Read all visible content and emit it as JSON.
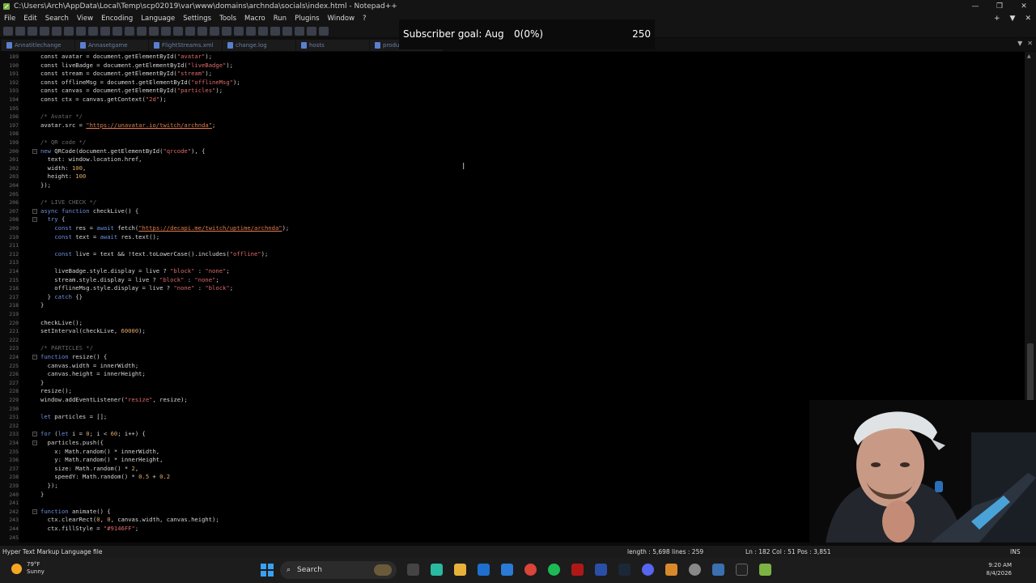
{
  "window": {
    "title": "C:\\Users\\Arch\\AppData\\Local\\Temp\\scp02019\\var\\www\\domains\\archnda\\socials\\index.html - Notepad++",
    "controls": [
      "—",
      "❐",
      "✕"
    ]
  },
  "menu": {
    "items": [
      "File",
      "Edit",
      "Search",
      "View",
      "Encoding",
      "Language",
      "Settings",
      "Tools",
      "Macro",
      "Run",
      "Plugins",
      "Window",
      "?"
    ],
    "right": [
      "+",
      "▼",
      "✕"
    ]
  },
  "tabs": [
    {
      "label": "Annatitlechange"
    },
    {
      "label": "Annasetgame"
    },
    {
      "label": "FlightStreams.xml"
    },
    {
      "label": "change.log"
    },
    {
      "label": "hosts"
    },
    {
      "label": "product.js"
    }
  ],
  "tabs_right": [
    "▼",
    "✕"
  ],
  "overlay": {
    "label": "Subscriber goal: Aug",
    "count": "0(0%)",
    "goal": "250"
  },
  "code": [
    {
      "n": "189",
      "t": [
        [
          "const avatar = document.getElementById(",
          ""
        ],
        [
          "\"avatar\"",
          "str"
        ],
        [
          ");",
          ""
        ]
      ]
    },
    {
      "n": "190",
      "t": [
        [
          "const liveBadge = document.getElementById(",
          ""
        ],
        [
          "\"liveBadge\"",
          "str"
        ],
        [
          ");",
          ""
        ]
      ]
    },
    {
      "n": "191",
      "t": [
        [
          "const stream = document.getElementById(",
          ""
        ],
        [
          "\"stream\"",
          "str"
        ],
        [
          ");",
          ""
        ]
      ]
    },
    {
      "n": "192",
      "t": [
        [
          "const offlineMsg = document.getElementById(",
          ""
        ],
        [
          "\"offlineMsg\"",
          "str"
        ],
        [
          ");",
          ""
        ]
      ]
    },
    {
      "n": "193",
      "t": [
        [
          "const canvas = document.getElementById(",
          ""
        ],
        [
          "\"particles\"",
          "str"
        ],
        [
          ");",
          ""
        ]
      ]
    },
    {
      "n": "194",
      "t": [
        [
          "const ctx = canvas.getContext(",
          ""
        ],
        [
          "\"2d\"",
          "str"
        ],
        [
          ");",
          ""
        ]
      ]
    },
    {
      "n": "195",
      "t": []
    },
    {
      "n": "196",
      "t": [
        [
          "/* Avatar */",
          "cm"
        ]
      ]
    },
    {
      "n": "197",
      "t": [
        [
          "avatar.src = ",
          ""
        ],
        [
          "\"https://unavatar.io/twitch/archnda\"",
          "url"
        ],
        [
          ";",
          ""
        ]
      ]
    },
    {
      "n": "198",
      "t": []
    },
    {
      "n": "199",
      "t": [
        [
          "/* QR code */",
          "cm"
        ]
      ]
    },
    {
      "n": "200",
      "t": [
        [
          "new",
          "kw"
        ],
        [
          " QRCode(document.getElementById(",
          ""
        ],
        [
          "\"qrcode\"",
          "str"
        ],
        [
          "), {",
          ""
        ]
      ]
    },
    {
      "n": "201",
      "t": [
        [
          "  text: window.location.href,",
          ""
        ]
      ]
    },
    {
      "n": "202",
      "t": [
        [
          "  width: ",
          ""
        ],
        [
          "100",
          "num"
        ],
        [
          ",",
          ""
        ]
      ]
    },
    {
      "n": "203",
      "t": [
        [
          "  height: ",
          ""
        ],
        [
          "100",
          "num"
        ]
      ]
    },
    {
      "n": "204",
      "t": [
        [
          "});",
          ""
        ]
      ]
    },
    {
      "n": "205",
      "t": []
    },
    {
      "n": "206",
      "t": [
        [
          "/* LIVE CHECK */",
          "cm"
        ]
      ]
    },
    {
      "n": "207",
      "t": [
        [
          "async function",
          "kw"
        ],
        [
          " checkLive() {",
          ""
        ]
      ]
    },
    {
      "n": "208",
      "t": [
        [
          "  ",
          ""
        ],
        [
          "try",
          "kw"
        ],
        [
          " {",
          ""
        ]
      ]
    },
    {
      "n": "209",
      "t": [
        [
          "    ",
          ""
        ],
        [
          "const",
          "kw"
        ],
        [
          " res = ",
          ""
        ],
        [
          "await",
          "kw"
        ],
        [
          " fetch(",
          ""
        ],
        [
          "\"https://decapi.me/twitch/uptime/archnda\"",
          "url"
        ],
        [
          ");",
          ""
        ]
      ]
    },
    {
      "n": "210",
      "t": [
        [
          "    ",
          ""
        ],
        [
          "const",
          "kw"
        ],
        [
          " text = ",
          ""
        ],
        [
          "await",
          "kw"
        ],
        [
          " res.text();",
          ""
        ]
      ]
    },
    {
      "n": "211",
      "t": []
    },
    {
      "n": "212",
      "t": [
        [
          "    ",
          ""
        ],
        [
          "const",
          "kw"
        ],
        [
          " live = text && !text.toLowerCase().includes(",
          ""
        ],
        [
          "\"offline\"",
          "str"
        ],
        [
          ");",
          ""
        ]
      ]
    },
    {
      "n": "213",
      "t": []
    },
    {
      "n": "214",
      "t": [
        [
          "    liveBadge.style.display = live ? ",
          ""
        ],
        [
          "\"block\"",
          "str"
        ],
        [
          " : ",
          ""
        ],
        [
          "\"none\"",
          "str"
        ],
        [
          ";",
          ""
        ]
      ]
    },
    {
      "n": "215",
      "t": [
        [
          "    stream.style.display = live ? ",
          ""
        ],
        [
          "\"block\"",
          "str"
        ],
        [
          " : ",
          ""
        ],
        [
          "\"none\"",
          "str"
        ],
        [
          ";",
          ""
        ]
      ]
    },
    {
      "n": "216",
      "t": [
        [
          "    offlineMsg.style.display = live ? ",
          ""
        ],
        [
          "\"none\"",
          "str"
        ],
        [
          " : ",
          ""
        ],
        [
          "\"block\"",
          "str"
        ],
        [
          ";",
          ""
        ]
      ]
    },
    {
      "n": "217",
      "t": [
        [
          "  } ",
          ""
        ],
        [
          "catch",
          "kw"
        ],
        [
          " {}",
          ""
        ]
      ]
    },
    {
      "n": "218",
      "t": [
        [
          "}",
          ""
        ]
      ]
    },
    {
      "n": "219",
      "t": []
    },
    {
      "n": "220",
      "t": [
        [
          "checkLive();",
          ""
        ]
      ]
    },
    {
      "n": "221",
      "t": [
        [
          "setInterval(checkLive, ",
          ""
        ],
        [
          "60000",
          "num"
        ],
        [
          ");",
          ""
        ]
      ]
    },
    {
      "n": "222",
      "t": []
    },
    {
      "n": "223",
      "t": [
        [
          "/* PARTICLES */",
          "cm"
        ]
      ]
    },
    {
      "n": "224",
      "t": [
        [
          "function",
          "kw"
        ],
        [
          " resize() {",
          ""
        ]
      ]
    },
    {
      "n": "225",
      "t": [
        [
          "  canvas.width = innerWidth;",
          ""
        ]
      ]
    },
    {
      "n": "226",
      "t": [
        [
          "  canvas.height = innerHeight;",
          ""
        ]
      ]
    },
    {
      "n": "227",
      "t": [
        [
          "}",
          ""
        ]
      ]
    },
    {
      "n": "228",
      "t": [
        [
          "resize();",
          ""
        ]
      ]
    },
    {
      "n": "229",
      "t": [
        [
          "window.addEventListener(",
          ""
        ],
        [
          "\"resize\"",
          "str"
        ],
        [
          ", resize);",
          ""
        ]
      ]
    },
    {
      "n": "230",
      "t": []
    },
    {
      "n": "231",
      "t": [
        [
          "let",
          "kw"
        ],
        [
          " particles = [];",
          ""
        ]
      ]
    },
    {
      "n": "232",
      "t": []
    },
    {
      "n": "233",
      "t": [
        [
          "for",
          "kw"
        ],
        [
          " (",
          ""
        ],
        [
          "let",
          "kw"
        ],
        [
          " i = ",
          ""
        ],
        [
          "0",
          "num"
        ],
        [
          "; i < ",
          ""
        ],
        [
          "60",
          "num"
        ],
        [
          "; i++) {",
          ""
        ]
      ]
    },
    {
      "n": "234",
      "t": [
        [
          "  particles.push({",
          ""
        ]
      ]
    },
    {
      "n": "235",
      "t": [
        [
          "    x: Math.random() * innerWidth,",
          ""
        ]
      ]
    },
    {
      "n": "236",
      "t": [
        [
          "    y: Math.random() * innerHeight,",
          ""
        ]
      ]
    },
    {
      "n": "237",
      "t": [
        [
          "    size: Math.random() * ",
          ""
        ],
        [
          "2",
          "num"
        ],
        [
          ",",
          ""
        ]
      ]
    },
    {
      "n": "238",
      "t": [
        [
          "    speedY: Math.random() * ",
          ""
        ],
        [
          "0.5",
          "num"
        ],
        [
          " + ",
          ""
        ],
        [
          "0.2",
          "num"
        ]
      ]
    },
    {
      "n": "239",
      "t": [
        [
          "  });",
          ""
        ]
      ]
    },
    {
      "n": "240",
      "t": [
        [
          "}",
          ""
        ]
      ]
    },
    {
      "n": "241",
      "t": []
    },
    {
      "n": "242",
      "t": [
        [
          "function",
          "kw"
        ],
        [
          " animate() {",
          ""
        ]
      ]
    },
    {
      "n": "243",
      "t": [
        [
          "  ctx.clearRect(",
          ""
        ],
        [
          "0",
          "num"
        ],
        [
          ", ",
          ""
        ],
        [
          "0",
          "num"
        ],
        [
          ", canvas.width, canvas.height);",
          ""
        ]
      ]
    },
    {
      "n": "244",
      "t": [
        [
          "  ctx.fillStyle = ",
          ""
        ],
        [
          "\"#9146FF\"",
          "str"
        ],
        [
          ";",
          ""
        ]
      ]
    },
    {
      "n": "245",
      "t": []
    }
  ],
  "status": {
    "language": "Hyper Text Markup Language file",
    "length": "length : 5,698    lines : 259",
    "position": "Ln : 182    Col : 51    Pos : 3,851",
    "mode": "INS"
  },
  "taskbar": {
    "temp": "79°F",
    "condition": "Sunny",
    "search_label": "Search",
    "time": "9:20 AM",
    "date": "8/4/2026"
  },
  "colors": {
    "keyword": "#6f8fdf",
    "string": "#e06a6a",
    "comment": "#6a6a6a",
    "number": "#e5a86a",
    "url": "#e07d4e"
  }
}
